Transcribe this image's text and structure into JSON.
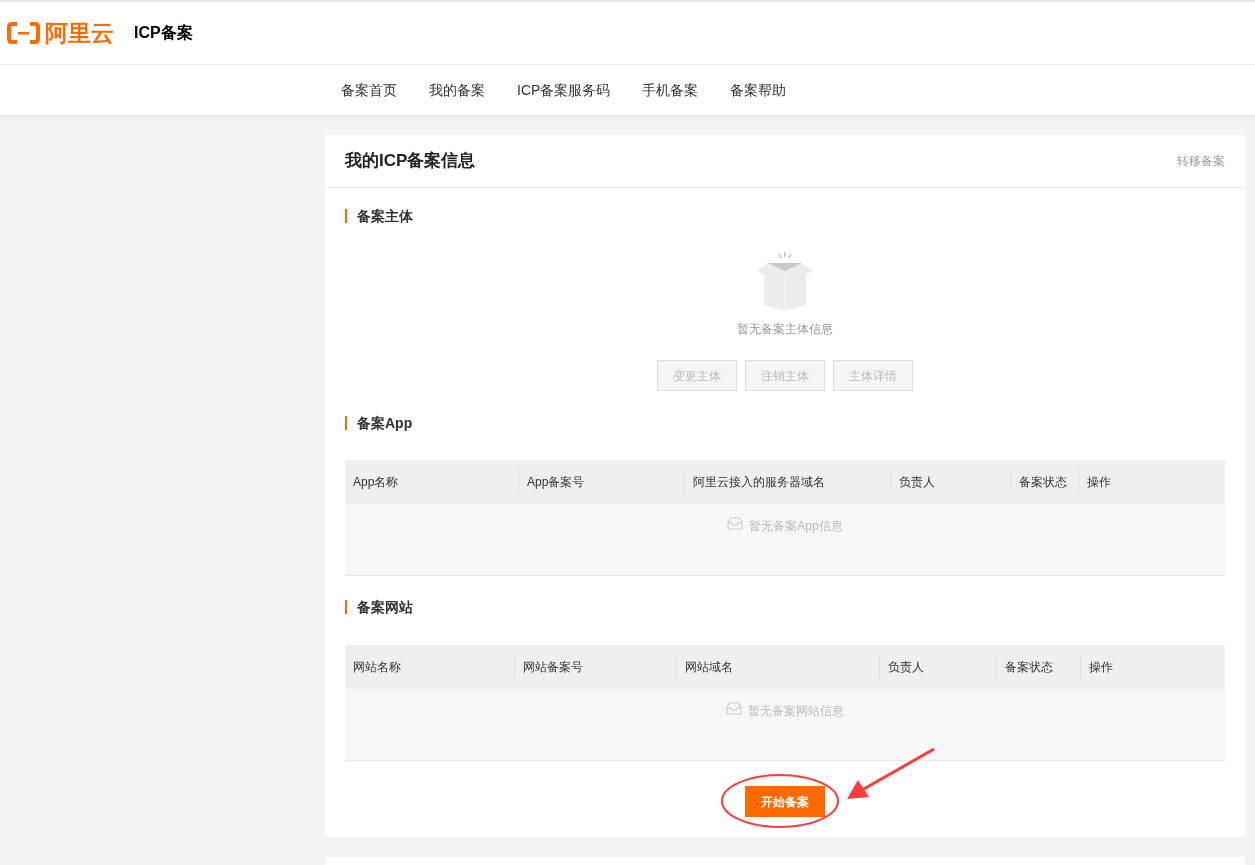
{
  "header": {
    "logo_text": "阿里云",
    "title": "ICP备案"
  },
  "nav": [
    {
      "label": "备案首页",
      "selected": false
    },
    {
      "label": "我的备案",
      "selected": false
    },
    {
      "label": "ICP备案服务码",
      "selected": false
    },
    {
      "label": "手机备案",
      "selected": false
    },
    {
      "label": "备案帮助",
      "selected": false
    }
  ],
  "card": {
    "title": "我的ICP备案信息",
    "link": "转移备案"
  },
  "subject_section": {
    "title": "备案主体",
    "empty_text": "暂无备案主体信息",
    "buttons": [
      {
        "label": "变更主体",
        "disabled": true
      },
      {
        "label": "注销主体",
        "disabled": true
      },
      {
        "label": "主体详情",
        "disabled": true
      }
    ]
  },
  "tables": [
    {
      "title": "备案App",
      "columns": [
        "App名称",
        "App备案号",
        "阿里云接入的服务器域名",
        "负责人",
        "备案状态",
        "操作"
      ],
      "empty_text": "暂无备案App信息"
    },
    {
      "title": "备案网站",
      "columns": [
        "网站名称",
        "网站备案号",
        "网站域名",
        "负责人",
        "备案状态",
        "操作"
      ],
      "empty_text": "暂无备案网站信息"
    }
  ],
  "primary_button": {
    "label": "开始备案"
  }
}
